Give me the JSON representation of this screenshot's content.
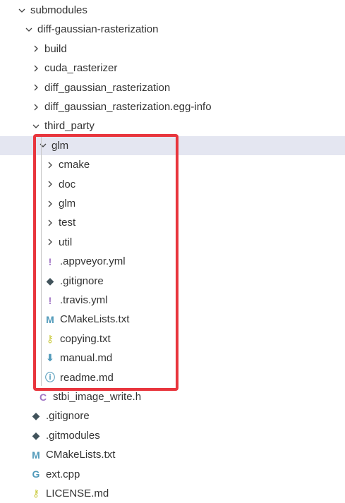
{
  "tree": [
    {
      "label": "submodules",
      "type": "folder",
      "expanded": true,
      "depth": 0,
      "icon": "chevron-down-icon"
    },
    {
      "label": "diff-gaussian-rasterization",
      "type": "folder",
      "expanded": true,
      "depth": 1,
      "icon": "chevron-down-icon"
    },
    {
      "label": "build",
      "type": "folder",
      "expanded": false,
      "depth": 2,
      "icon": "chevron-right-icon"
    },
    {
      "label": "cuda_rasterizer",
      "type": "folder",
      "expanded": false,
      "depth": 2,
      "icon": "chevron-right-icon"
    },
    {
      "label": "diff_gaussian_rasterization",
      "type": "folder",
      "expanded": false,
      "depth": 2,
      "icon": "chevron-right-icon"
    },
    {
      "label": "diff_gaussian_rasterization.egg-info",
      "type": "folder",
      "expanded": false,
      "depth": 2,
      "icon": "chevron-right-icon"
    },
    {
      "label": "third_party",
      "type": "folder",
      "expanded": true,
      "depth": 2,
      "icon": "chevron-down-icon"
    },
    {
      "label": "glm",
      "type": "folder",
      "expanded": true,
      "depth": 3,
      "selected": true,
      "icon": "chevron-down-icon"
    },
    {
      "label": "cmake",
      "type": "folder",
      "expanded": false,
      "depth": 4,
      "icon": "chevron-right-icon"
    },
    {
      "label": "doc",
      "type": "folder",
      "expanded": false,
      "depth": 4,
      "icon": "chevron-right-icon"
    },
    {
      "label": "glm",
      "type": "folder",
      "expanded": false,
      "depth": 4,
      "icon": "chevron-right-icon"
    },
    {
      "label": "test",
      "type": "folder",
      "expanded": false,
      "depth": 4,
      "icon": "chevron-right-icon"
    },
    {
      "label": "util",
      "type": "folder",
      "expanded": false,
      "depth": 4,
      "icon": "chevron-right-icon"
    },
    {
      "label": ".appveyor.yml",
      "type": "file",
      "depth": 4,
      "icon": "yaml-icon",
      "glyph": "!",
      "color": "#a074c4"
    },
    {
      "label": ".gitignore",
      "type": "file",
      "depth": 4,
      "icon": "git-icon",
      "glyph": "◆",
      "color": "#41535b"
    },
    {
      "label": ".travis.yml",
      "type": "file",
      "depth": 4,
      "icon": "yaml-icon",
      "glyph": "!",
      "color": "#a074c4"
    },
    {
      "label": "CMakeLists.txt",
      "type": "file",
      "depth": 4,
      "icon": "markdown-icon",
      "glyph": "M",
      "color": "#519aba"
    },
    {
      "label": "copying.txt",
      "type": "file",
      "depth": 4,
      "icon": "license-key-icon",
      "glyph": "⚷",
      "color": "#cbcb41"
    },
    {
      "label": "manual.md",
      "type": "file",
      "depth": 4,
      "icon": "download-arrow-icon",
      "glyph": "⬇",
      "color": "#519aba"
    },
    {
      "label": "readme.md",
      "type": "file",
      "depth": 4,
      "icon": "info-icon",
      "glyph": "ⓘ",
      "color": "#519aba"
    },
    {
      "label": "stbi_image_write.h",
      "type": "file",
      "depth": 3,
      "icon": "c-header-icon",
      "glyph": "C",
      "color": "#a074c4"
    },
    {
      "label": ".gitignore",
      "type": "file",
      "depth": 2,
      "icon": "git-icon",
      "glyph": "◆",
      "color": "#41535b"
    },
    {
      "label": ".gitmodules",
      "type": "file",
      "depth": 2,
      "icon": "git-icon",
      "glyph": "◆",
      "color": "#41535b"
    },
    {
      "label": "CMakeLists.txt",
      "type": "file",
      "depth": 2,
      "icon": "markdown-icon",
      "glyph": "M",
      "color": "#519aba"
    },
    {
      "label": "ext.cpp",
      "type": "file",
      "depth": 2,
      "icon": "cpp-icon",
      "glyph": "G",
      "color": "#519aba"
    },
    {
      "label": "LICENSE.md",
      "type": "file",
      "depth": 2,
      "icon": "license-key-icon",
      "glyph": "⚷",
      "color": "#cbcb41"
    }
  ],
  "colors": {
    "highlight": "#e8353d",
    "selected_row": "#e4e6f1",
    "text": "#333333"
  }
}
